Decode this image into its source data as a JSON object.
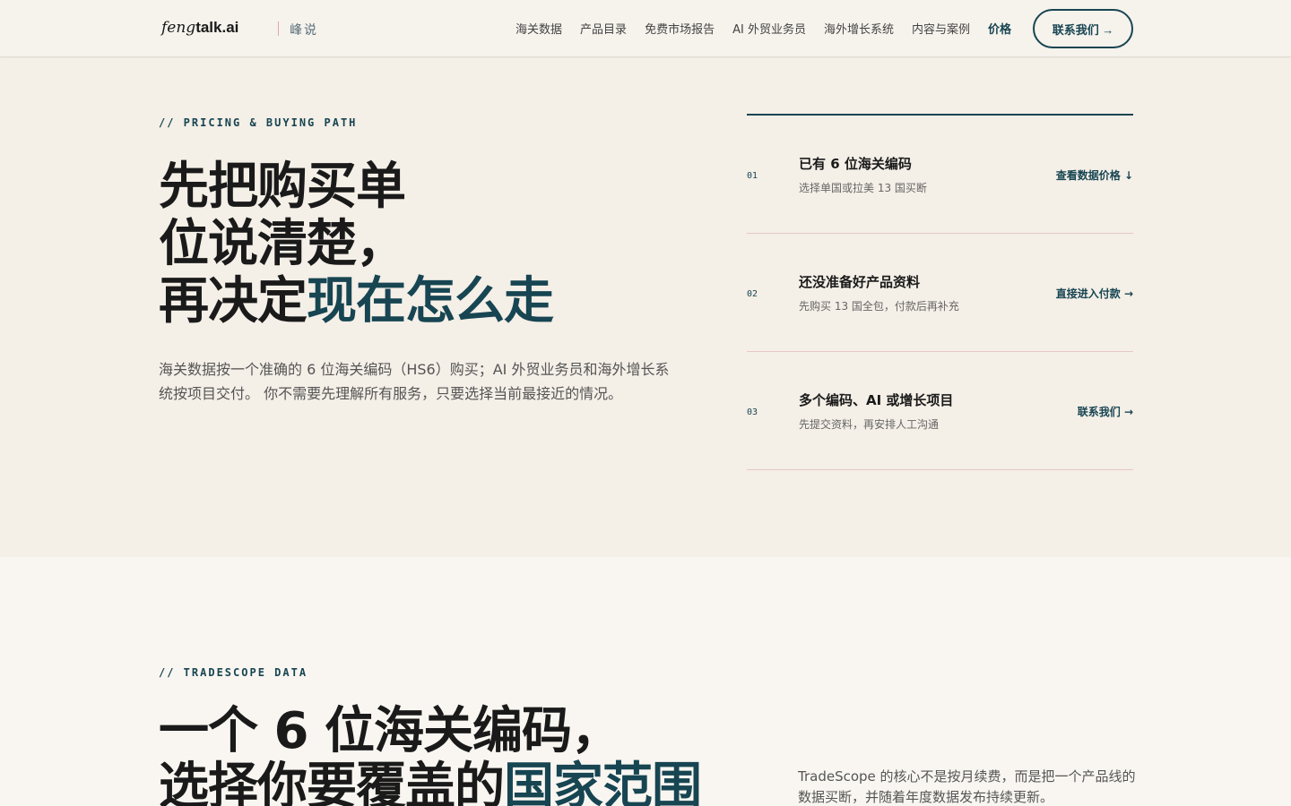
{
  "header": {
    "logo_italic": "feng",
    "logo_bold": "talk.ai",
    "brand_cn": "峰说",
    "nav": [
      {
        "label": "海关数据"
      },
      {
        "label": "产品目录"
      },
      {
        "label": "免费市场报告"
      },
      {
        "label": "AI 外贸业务员"
      },
      {
        "label": "海外增长系统"
      },
      {
        "label": "内容与案例"
      },
      {
        "label": "价格"
      }
    ],
    "cta_label": "联系我们 →"
  },
  "pricing": {
    "eyebrow": "// PRICING & BUYING PATH",
    "headline_l1": "先把购买单",
    "headline_l2": "位说清楚，",
    "headline_l3a": "再决定",
    "headline_l3b": "现在怎么走",
    "lead": "海关数据按一个准确的 6 位海关编码（HS6）购买；AI 外贸业务员和海外增长系统按项目交付。 你不需要先理解所有服务，只要选择当前最接近的情况。",
    "steps": [
      {
        "num": "01",
        "title": "已有 6 位海关编码",
        "desc": "选择单国或拉美 13 国买断",
        "link": "查看数据价格 ↓"
      },
      {
        "num": "02",
        "title": "还没准备好产品资料",
        "desc": "先购买 13 国全包，付款后再补充",
        "link": "直接进入付款 →"
      },
      {
        "num": "03",
        "title": "多个编码、AI 或增长项目",
        "desc": "先提交资料，再安排人工沟通",
        "link": "联系我们 →"
      }
    ]
  },
  "tradescope": {
    "eyebrow": "// TRADESCOPE DATA",
    "headline_l1": "一个 6 位海关编码，",
    "headline_l2a": "选择你要覆盖的",
    "headline_l2b": "国家范围",
    "paragraph": "TradeScope 的核心不是按月续费，而是把一个产品线的数据买断，并随着年度数据发布持续更新。"
  },
  "colors": {
    "accent": "#174552",
    "bg_top": "#f4efe7",
    "bg_bottom": "#f9f6f1",
    "divider": "#e7c8c4"
  }
}
